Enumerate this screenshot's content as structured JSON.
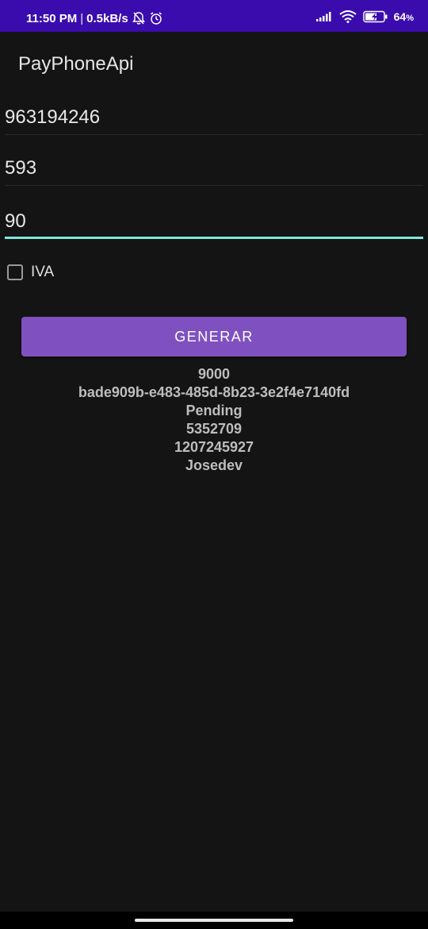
{
  "status_bar": {
    "time": "11:50 PM",
    "network_speed": "0.5kB/s",
    "icons": [
      "silent-alarm-icon",
      "alarm-clock-icon",
      "signal-icon",
      "wifi-icon",
      "battery-charging-icon"
    ],
    "battery": "64",
    "battery_unit": "%",
    "background": "#3a0cae"
  },
  "app_bar": {
    "title": "PayPhoneApi"
  },
  "form": {
    "phone": "963194246",
    "country_code": "593",
    "amount": "90",
    "iva_label": "IVA",
    "iva_checked": false,
    "focus_color": "#7fe8db"
  },
  "button": {
    "label": "GENERAR",
    "color": "#7f51c0"
  },
  "results": [
    "9000",
    "bade909b-e483-485d-8b23-3e2f4e7140fd",
    "Pending",
    "5352709",
    "1207245927",
    "Josedev"
  ]
}
